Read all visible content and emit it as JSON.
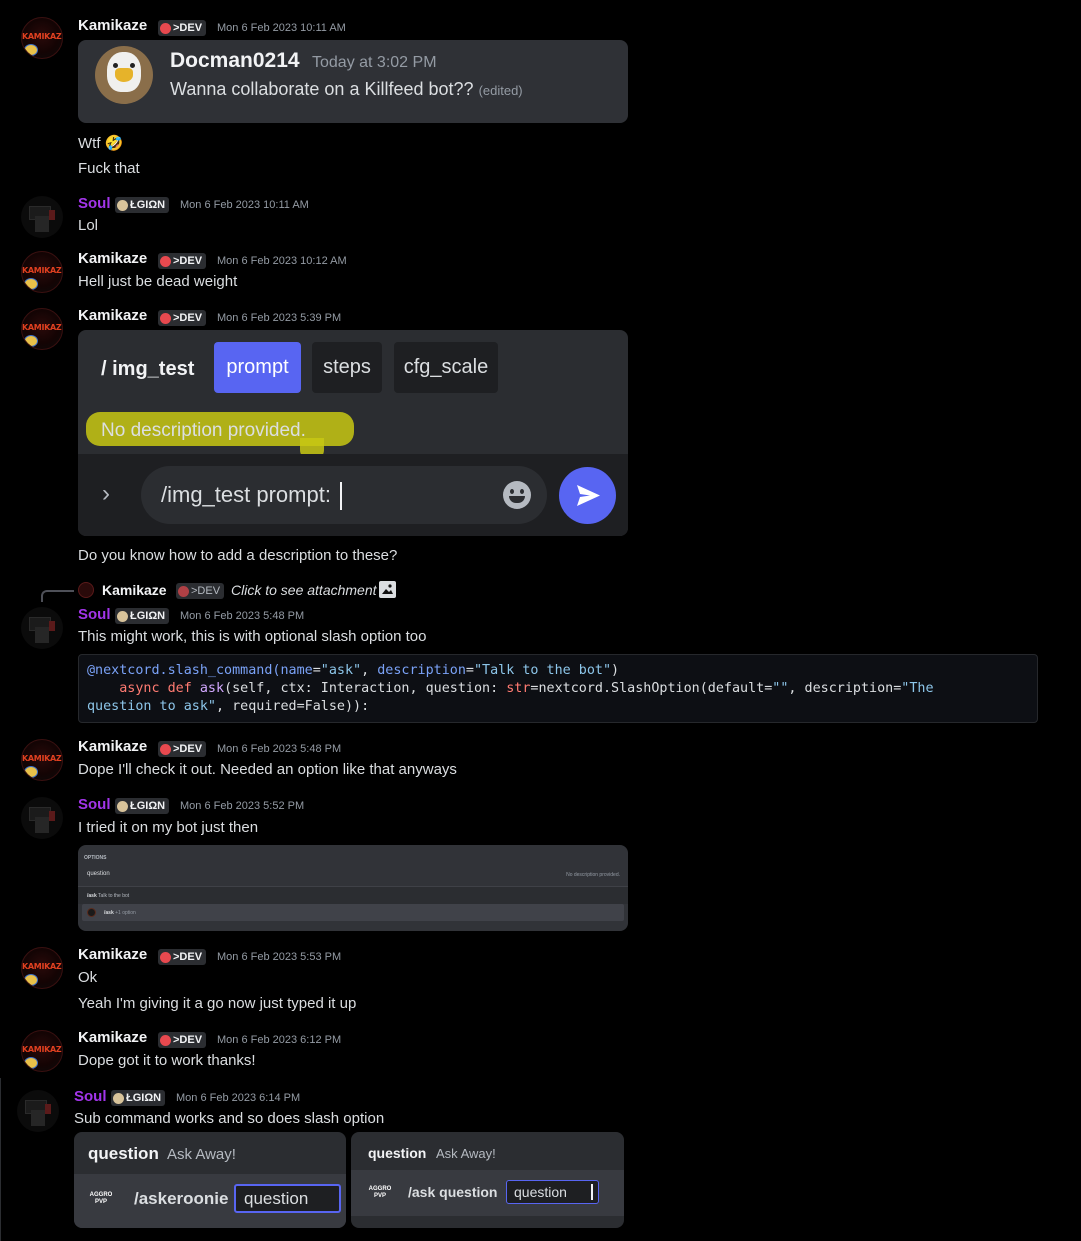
{
  "messages": {
    "m1": {
      "author": "Kamikaze",
      "tag": ">DEV",
      "timestamp": "Mon 6 Feb 2023 10:11 AM",
      "lines": [
        "Wtf 🤣",
        "Fuck that"
      ]
    },
    "m2": {
      "author": "Soul",
      "tag": "ŁGIΩN",
      "timestamp": "Mon 6 Feb 2023 10:11 AM",
      "text": "Lol"
    },
    "m3": {
      "author": "Kamikaze",
      "tag": ">DEV",
      "timestamp": "Mon 6 Feb 2023 10:12 AM",
      "text": "Hell just be dead weight"
    },
    "m4": {
      "author": "Kamikaze",
      "tag": ">DEV",
      "timestamp": "Mon 6 Feb 2023 5:39 PM",
      "text": "Do you know how to add a description to these?"
    },
    "m5": {
      "author": "Soul",
      "tag": "ŁGIΩN",
      "timestamp": "Mon 6 Feb 2023 5:48 PM",
      "text": "This might work, this is with optional slash option too"
    },
    "m6": {
      "author": "Kamikaze",
      "tag": ">DEV",
      "timestamp": "Mon 6 Feb 2023 5:48 PM",
      "text": "Dope I'll check it out. Needed an option like that anyways"
    },
    "m7": {
      "author": "Soul",
      "tag": "ŁGIΩN",
      "timestamp": "Mon 6 Feb 2023 5:52 PM",
      "text": "I tried it on my bot just then"
    },
    "m8": {
      "author": "Kamikaze",
      "tag": ">DEV",
      "timestamp": "Mon 6 Feb 2023 5:53 PM",
      "lines": [
        "Ok",
        "Yeah I'm giving it a go now just typed it up"
      ]
    },
    "m9": {
      "author": "Kamikaze",
      "tag": ">DEV",
      "timestamp": "Mon 6 Feb 2023 6:12 PM",
      "text": "Dope got it to work thanks!"
    },
    "m10": {
      "author": "Soul",
      "tag": "ŁGIΩN",
      "timestamp": "Mon 6 Feb 2023 6:14 PM",
      "text": "Sub command works and so does slash option"
    }
  },
  "embed1": {
    "avatar_icon": "eagle-avatar",
    "author": "Docman0214",
    "time": "Today at 3:02 PM",
    "text": "Wanna collaborate on a Killfeed bot??",
    "edited": "(edited)"
  },
  "embed2": {
    "command": "/ img_test",
    "options": [
      "prompt",
      "steps",
      "cfg_scale"
    ],
    "description": "No description provided.",
    "input_value": "/img_test prompt:",
    "accent": "#5865f2",
    "highlight": "#c8c813"
  },
  "reply": {
    "author": "Kamikaze",
    "tag": ">DEV",
    "text": "Click to see attachment"
  },
  "code": {
    "line1": {
      "decorator": "@nextcord.slash_command(",
      "arg1": "name",
      "eq": "=",
      "s1": "\"ask\"",
      "sep": ", ",
      "arg2": "description",
      "s2": "\"Talk to the bot\"",
      "close": ")"
    },
    "line2": {
      "indent": "    ",
      "kw1": "async",
      "kw2": "def",
      "fn": "ask",
      "rest": "(self, ctx: Interaction, question: ",
      "type": "str",
      "rest2": "=nextcord.SlashOption(default=",
      "s3": "\"\"",
      "rest3": ", description=",
      "s4": "\"The"
    },
    "line3": {
      "s5": "question to ask\"",
      "rest4": ", required=False)):"
    }
  },
  "embed3": {
    "header": "OPTIONS",
    "option": "question",
    "option_desc": "No description provided.",
    "row1_cmd": "/ask",
    "row1_desc": "Talk to the bot",
    "row2_cmd": "/ask",
    "row2_desc": "+1 option"
  },
  "embed4a": {
    "option": "question",
    "desc": "Ask Away!",
    "bot": "AGGRO PVP",
    "cmd": "/askeroonie",
    "input": "question"
  },
  "embed4b": {
    "option": "question",
    "desc": "Ask Away!",
    "bot": "AGGRO PVP",
    "cmd": "/ask question",
    "input": "question"
  }
}
